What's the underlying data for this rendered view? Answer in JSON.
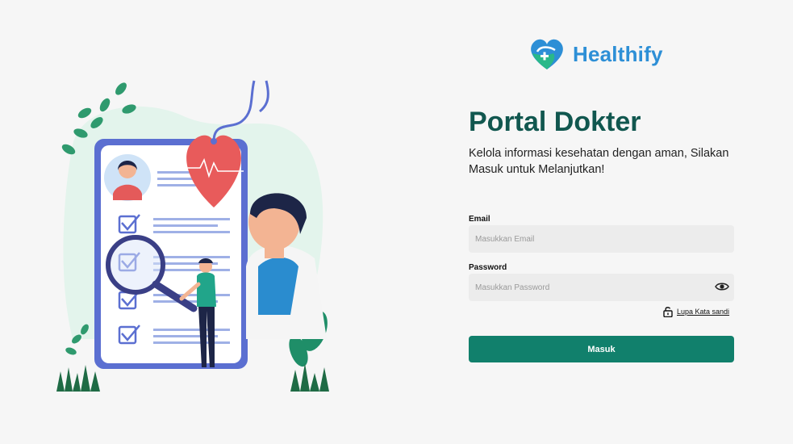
{
  "brand": {
    "name": "Healthify"
  },
  "header": {
    "title": "Portal Dokter",
    "subtitle": "Kelola informasi kesehatan dengan aman, Silakan Masuk untuk Melanjutkan!"
  },
  "form": {
    "email": {
      "label": "Email",
      "placeholder": "Masukkan Email",
      "value": ""
    },
    "password": {
      "label": "Password",
      "placeholder": "Masukkan Password",
      "value": ""
    },
    "forgot_label": "Lupa Kata sandi",
    "submit_label": "Masuk"
  },
  "icons": {
    "logo": "heart-cross-logo-icon",
    "password_toggle": "eye-icon",
    "forgot": "unlock-icon"
  },
  "colors": {
    "brand_blue": "#2d8fd6",
    "primary_green": "#11806c",
    "title_green": "#11574f",
    "input_bg": "#ececec",
    "page_bg": "#f6f6f6"
  }
}
